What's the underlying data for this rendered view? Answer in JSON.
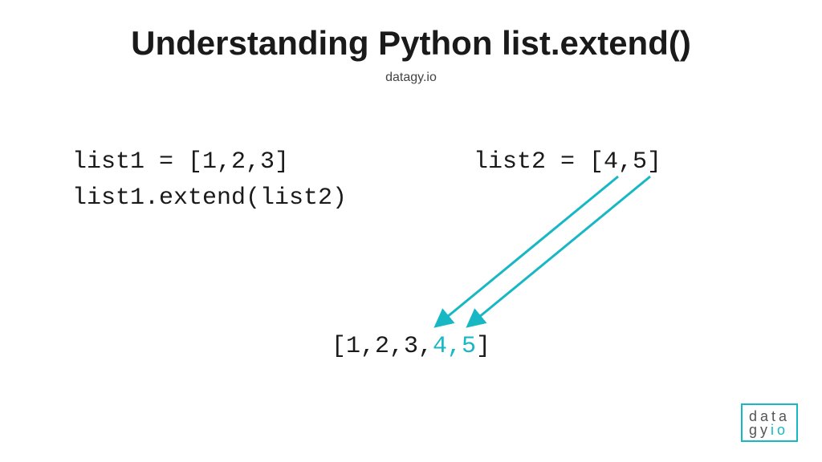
{
  "title": "Understanding Python list.extend()",
  "subtitle": "datagy.io",
  "code": {
    "line1": "list1 = [1,2,3]",
    "line2": "list1.extend(list2)",
    "right": "list2 = [4,5]"
  },
  "result": {
    "prefix": "[1,2,3,",
    "highlight": "4,5",
    "suffix": "]"
  },
  "logo": {
    "line1": "data",
    "line2a": "gy",
    "line2b": "io"
  },
  "colors": {
    "accent": "#18b7c4"
  }
}
